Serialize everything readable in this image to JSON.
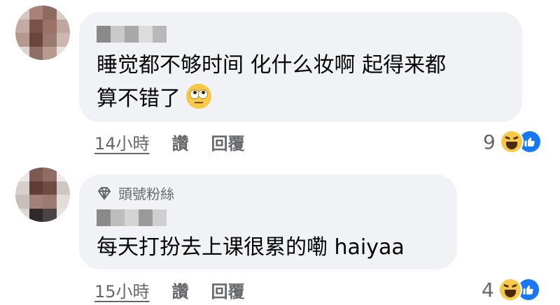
{
  "comments": [
    {
      "text_line1": "睡觉都不够时间 化什么妆啊 起得来都",
      "text_line2": "算不错了",
      "emoji": "face-with-rolling-eyes",
      "time": "14小時",
      "like_label": "讚",
      "reply_label": "回覆",
      "reaction_count": "9"
    },
    {
      "badge": "頭號粉絲",
      "text": "每天打扮去上课很累的嘞 haiyaa",
      "time": "15小時",
      "like_label": "讚",
      "reply_label": "回覆",
      "reaction_count": "4"
    }
  ],
  "colors": {
    "bubble": "#f0f2f5",
    "secondary_text": "#65676b",
    "like_blue": "#1877f2",
    "haha_yellow": "#f7c948"
  }
}
